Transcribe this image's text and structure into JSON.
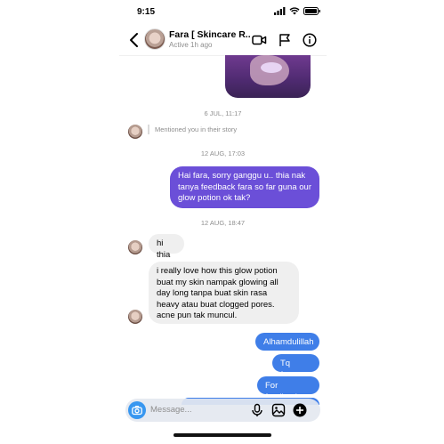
{
  "status_bar": {
    "time": "9:15"
  },
  "header": {
    "name": "Fara [ Skincare R...",
    "status": "Active 1h ago",
    "icons": [
      "back-chevron-icon",
      "video-camera-icon",
      "flag-icon",
      "info-icon"
    ]
  },
  "thread": {
    "timestamps": [
      "6 JUL, 11:17",
      "12 AUG, 17:03",
      "12 AUG, 18:47"
    ],
    "story_mention": "Mentioned you in their story",
    "messages": [
      {
        "from": "me",
        "text": "Hai fara, sorry ganggu u..  thia nak tanya feedback fara so far guna our glow potion ok tak?"
      },
      {
        "from": "them",
        "text": "hi thia"
      },
      {
        "from": "them",
        "text": "i really love how this glow potion buat my skin nampak glowing all day long tanpa buat skin rasa heavy atau buat clogged pores. acne pun tak muncul."
      },
      {
        "from": "me",
        "text": "Alhamdulillah"
      },
      {
        "from": "me",
        "text": "Tq faraaa"
      },
      {
        "from": "me",
        "text": "For feedback"
      }
    ]
  },
  "composer": {
    "placeholder": "Message...",
    "icons": [
      "camera-icon",
      "microphone-icon",
      "gallery-icon",
      "plus-icon"
    ]
  },
  "colors": {
    "outgoing_purple": "#6b4fd8",
    "outgoing_blue": "#3f7ee8",
    "incoming_gray": "#efefef",
    "camera_button": "#3897f0"
  }
}
